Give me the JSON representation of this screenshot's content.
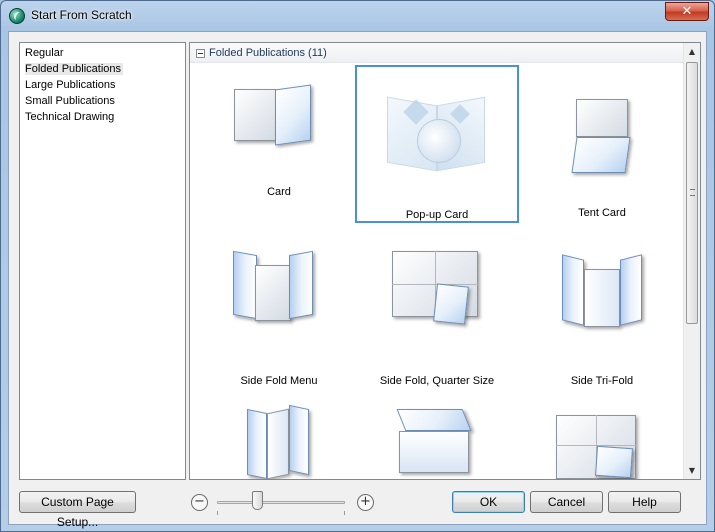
{
  "window": {
    "title": "Start From Scratch",
    "close_glyph": "✕"
  },
  "categories": [
    {
      "label": "Regular",
      "selected": false
    },
    {
      "label": "Folded Publications",
      "selected": true
    },
    {
      "label": "Large Publications",
      "selected": false
    },
    {
      "label": "Small Publications",
      "selected": false
    },
    {
      "label": "Technical Drawing",
      "selected": false
    }
  ],
  "gallery": {
    "group_title": "Folded Publications (11)",
    "collapse_glyph": "−",
    "scroll_up_glyph": "▲",
    "scroll_down_glyph": "▼",
    "selected_index": 1,
    "templates": [
      {
        "label": "Card",
        "icon": "card-icon"
      },
      {
        "label": "Pop-up Card",
        "icon": "popup-card-icon"
      },
      {
        "label": "Tent Card",
        "icon": "tent-card-icon"
      },
      {
        "label": "Side Fold Menu",
        "icon": "side-fold-menu-icon"
      },
      {
        "label": "Side Fold, Quarter Size",
        "icon": "side-fold-quarter-icon"
      },
      {
        "label": "Side Tri-Fold",
        "icon": "side-tri-fold-icon"
      },
      {
        "label": "",
        "icon": "z-fold-icon"
      },
      {
        "label": "",
        "icon": "top-fold-icon"
      },
      {
        "label": "",
        "icon": "quarter-fold-icon"
      }
    ]
  },
  "footer": {
    "custom_page_setup_label": "Custom Page Setup...",
    "zoom_minus_glyph": "−",
    "zoom_plus_glyph": "+",
    "zoom_level": 0.3,
    "ok_label": "OK",
    "cancel_label": "Cancel",
    "help_label": "Help"
  },
  "colors": {
    "selection_border": "#4a90d9",
    "page_blue": "#b8d2f0"
  }
}
